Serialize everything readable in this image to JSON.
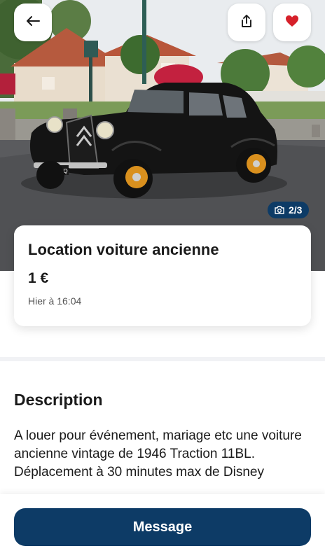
{
  "gallery": {
    "counter": "2/3",
    "photo": "photo-vintage-black-car"
  },
  "actions": {
    "back_icon": "arrow-left-icon",
    "share_icon": "share-icon",
    "favorite_icon": "heart-icon",
    "favorite_color": "#d6202a",
    "camera_icon": "camera-icon"
  },
  "listing": {
    "title": "Location voiture ancienne",
    "price": "1 €",
    "date": "Hier à 16:04"
  },
  "description": {
    "heading": "Description",
    "text": "A louer pour événement, mariage etc une voiture ancienne vintage de 1946 Traction 11BL.\nDéplacement à 30 minutes max de Disney"
  },
  "footer": {
    "message_label": "Message"
  },
  "colors": {
    "primary": "#0d3b66",
    "background": "#ffffff"
  }
}
